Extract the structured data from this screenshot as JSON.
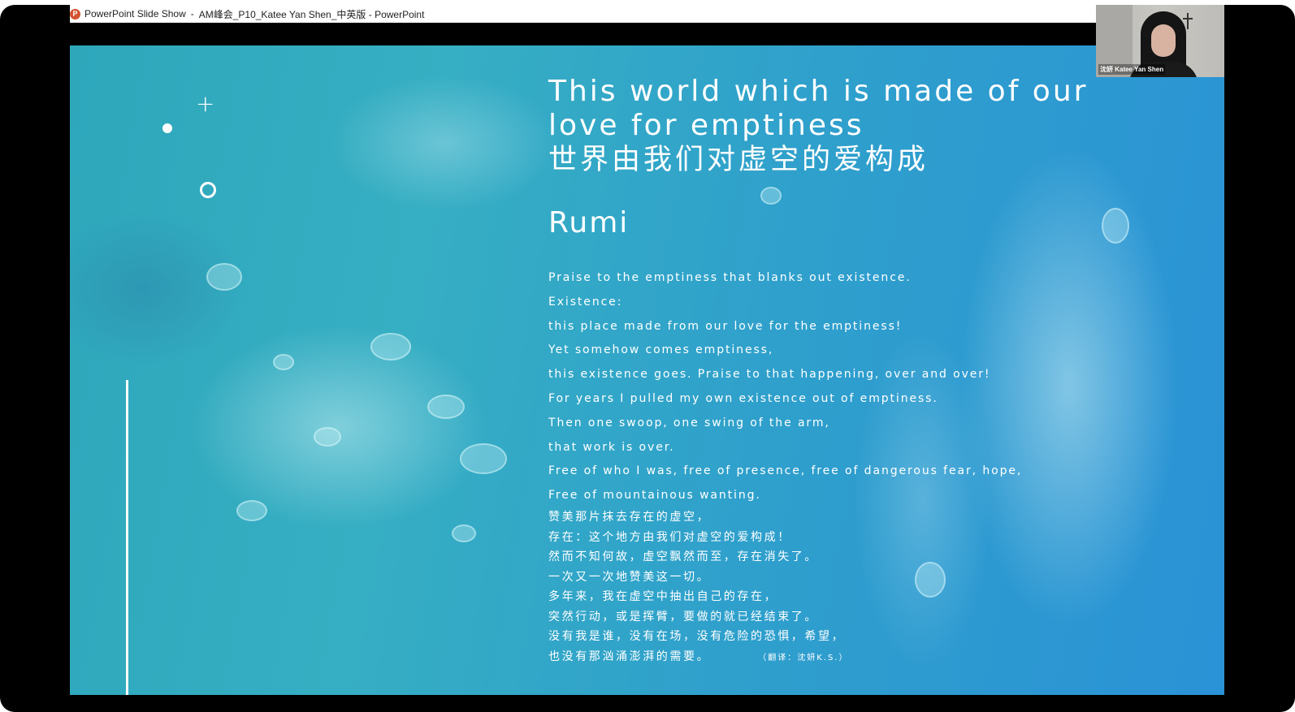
{
  "window": {
    "app_icon_glyph": "P",
    "app_name": "PowerPoint Slide Show",
    "separator": "-",
    "document_title": "AM峰会_P10_Katee Yan Shen_中英版 - PowerPoint"
  },
  "slide": {
    "title_en": "This world which is made of our love for emptiness",
    "title_cn": "世界由我们对虚空的爱构成",
    "author": "Rumi",
    "poem_en": [
      "Praise to the emptiness that blanks out existence.",
      "Existence:",
      "this place made from our love for the emptiness!",
      "Yet somehow comes emptiness,",
      "this existence goes. Praise to that happening, over and over!",
      "For years I pulled my own existence out of emptiness.",
      "Then one swoop, one swing of the arm,",
      "that work is over.",
      "Free of who I was, free of presence, free of dangerous fear, hope,",
      "Free of mountainous wanting."
    ],
    "poem_cn": [
      "赞美那片抹去存在的虚空，",
      "存在：这个地方由我们对虚空的爱构成！",
      "然而不知何故，虚空飘然而至，存在消失了。",
      "一次又一次地赞美这一切。",
      "多年来，我在虚空中抽出自己的存在，",
      "突然行动，或是挥臂，要做的就已经结束了。",
      "没有我是谁，没有在场，没有危险的恐惧，希望，",
      "也没有那汹涌澎湃的需要。"
    ],
    "credit": "（翻译：沈妍K.S.）",
    "decorations": [
      "dot-icon",
      "plus-icon",
      "ring-icon",
      "vertical-line"
    ]
  },
  "webcam": {
    "participant_name": "沈妍 Katee Yan Shen"
  },
  "colors": {
    "slide_background": "#2fa4c8",
    "text": "#ffffff",
    "frame": "#000000",
    "app_icon": "#d35230"
  }
}
